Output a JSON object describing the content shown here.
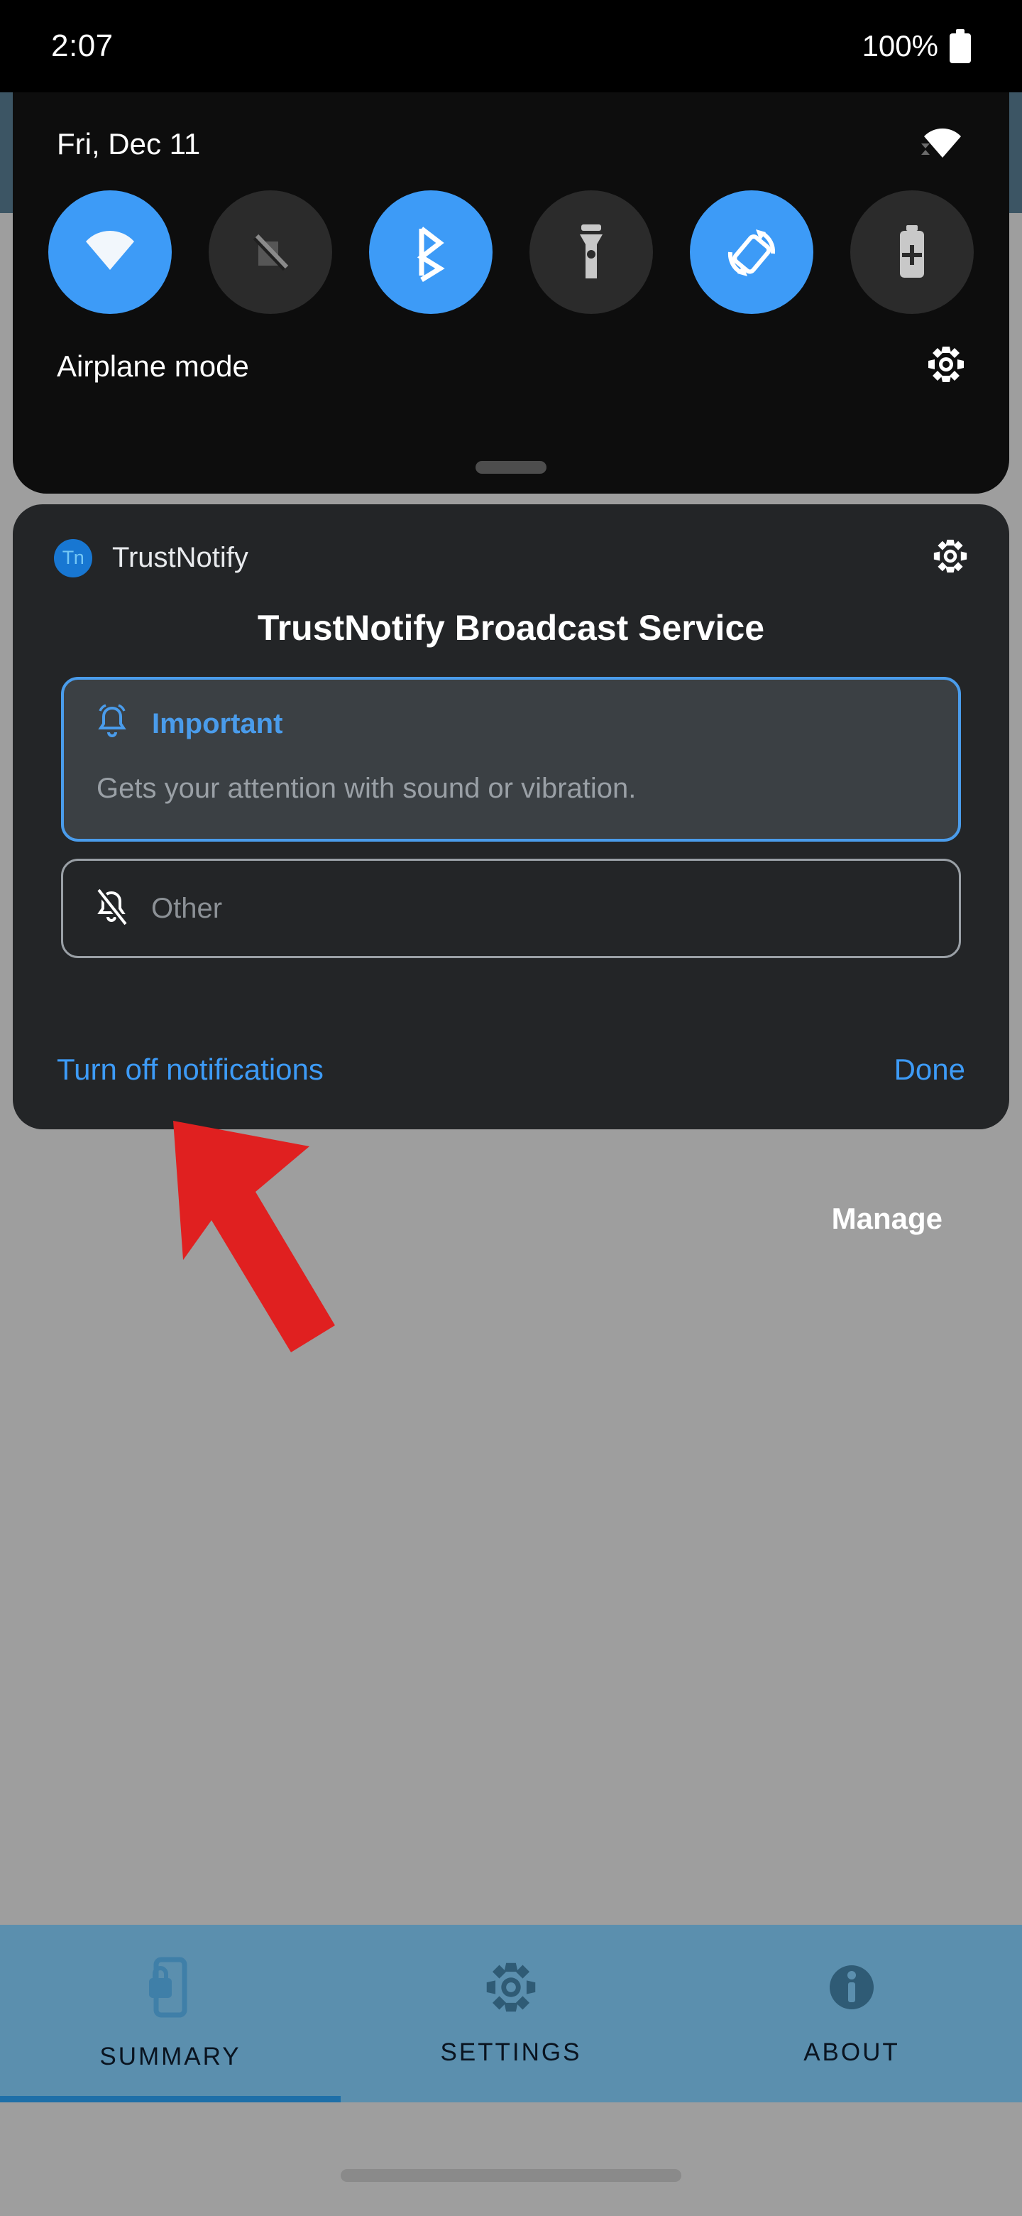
{
  "status_bar": {
    "time": "2:07",
    "battery_percent": "100%",
    "battery_icon": "battery-full-icon",
    "wifi_icon": "wifi-icon"
  },
  "quick_settings": {
    "date": "Fri, Dec 11",
    "wifi_status_icon": "wifi-icon",
    "footer_label": "Airplane mode",
    "settings_icon": "gear-icon",
    "drag_handle": "drag-handle",
    "accent_on": "#3d9bf7",
    "tile_off_bg": "#2b2b2b",
    "tiles": [
      {
        "name": "wifi",
        "icon": "wifi-icon",
        "state": "on"
      },
      {
        "name": "mobile-data",
        "icon": "cellular-off-icon",
        "state": "off"
      },
      {
        "name": "bluetooth",
        "icon": "bluetooth-icon",
        "state": "on"
      },
      {
        "name": "flashlight",
        "icon": "flashlight-icon",
        "state": "off"
      },
      {
        "name": "auto-rotate",
        "icon": "auto-rotate-icon",
        "state": "on"
      },
      {
        "name": "battery-saver",
        "icon": "battery-plus-icon",
        "state": "off"
      }
    ]
  },
  "notification": {
    "app_initials": "Tn",
    "app_name": "TrustNotify",
    "settings_icon": "gear-icon",
    "title": "TrustNotify Broadcast Service",
    "options": [
      {
        "label": "Important",
        "description": "Gets your attention with sound or vibration.",
        "icon": "bell-ringing-icon",
        "selected": true,
        "accent": "#4a9ceb"
      },
      {
        "label": "Other",
        "description": "",
        "icon": "bell-off-icon",
        "selected": false
      }
    ],
    "turn_off_label": "Turn off notifications",
    "done_label": "Done"
  },
  "shade": {
    "manage_label": "Manage",
    "scrim_color": "#9e9e9e"
  },
  "annotation": {
    "arrow_color": "#e02020",
    "arrow_points_to": "Turn off notifications"
  },
  "tab_bar": {
    "background": "#5b8fae",
    "indicator_color": "#1e6fa8",
    "tabs": [
      {
        "label": "SUMMARY",
        "icon": "phone-lock-icon",
        "active": true
      },
      {
        "label": "SETTINGS",
        "icon": "gear-icon",
        "active": false
      },
      {
        "label": "ABOUT",
        "icon": "info-icon",
        "active": false
      }
    ]
  }
}
